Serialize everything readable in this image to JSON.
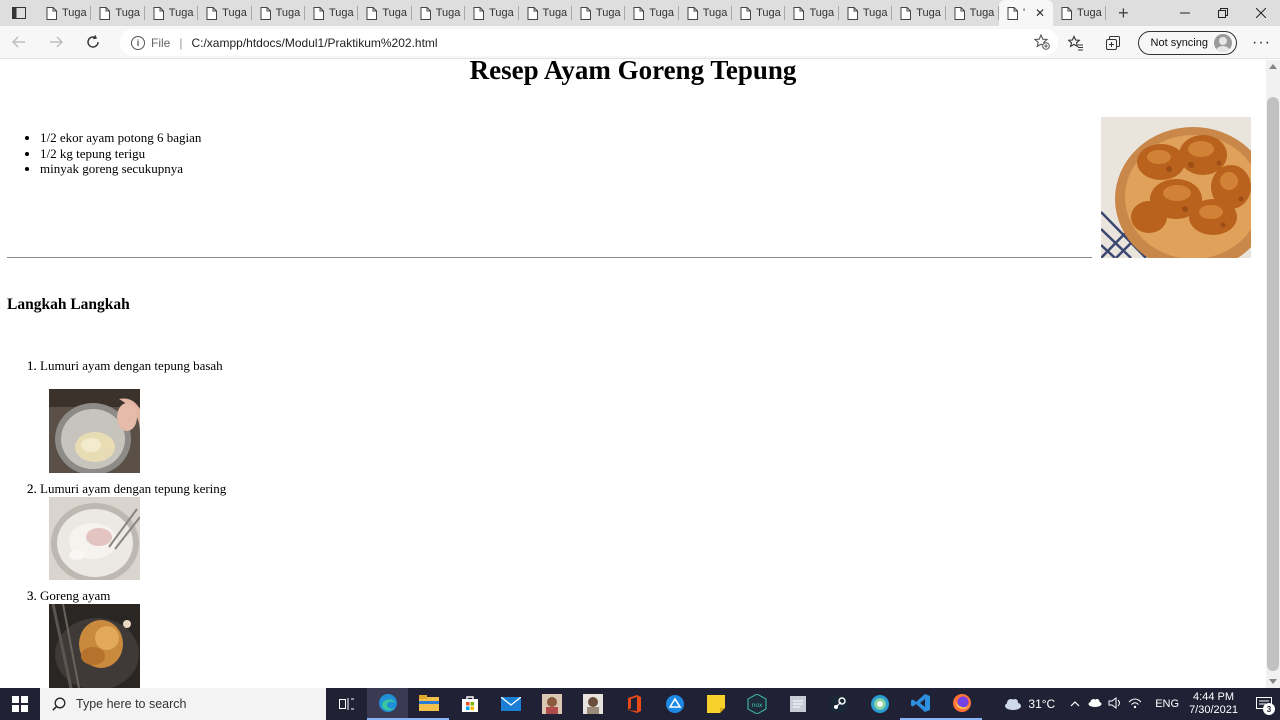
{
  "browser": {
    "tabs": [
      {
        "label": "Tuga"
      },
      {
        "label": "Tuga"
      },
      {
        "label": "Tuga"
      },
      {
        "label": "Tuga"
      },
      {
        "label": "Tuga"
      },
      {
        "label": "Tuga"
      },
      {
        "label": "Tuga"
      },
      {
        "label": "Tuga"
      },
      {
        "label": "Tuga"
      },
      {
        "label": "Tuga"
      },
      {
        "label": "Tuga"
      },
      {
        "label": "Tuga"
      },
      {
        "label": "Tuga"
      },
      {
        "label": "Tuga"
      },
      {
        "label": "Tuga"
      },
      {
        "label": "Tuga"
      },
      {
        "label": "Tuga"
      },
      {
        "label": "Tuga"
      },
      {
        "label": "'",
        "active": true
      },
      {
        "label": "Tuga"
      }
    ],
    "address": {
      "scheme_label": "File",
      "url": "C:/xampp/htdocs/Modul1/Praktikum%202.html"
    },
    "profile_label": "Not syncing"
  },
  "page": {
    "title": "Resep Ayam Goreng Tepung",
    "ingredients": [
      "1/2 ekor ayam potong 6 bagian",
      "1/2 kg tepung terigu",
      "minyak goreng secukupnya"
    ],
    "steps_heading": "Langkah Langkah",
    "steps": [
      {
        "num": "1.",
        "text": "Lumuri ayam dengan tepung basah"
      },
      {
        "num": "2.",
        "text": "Lumuri ayam dengan tepung kering"
      },
      {
        "num": "3.",
        "text": "Goreng ayam"
      }
    ]
  },
  "taskbar": {
    "search_placeholder": "Type here to search",
    "weather": "31°C",
    "language": "ENG",
    "time": "4:44 PM",
    "date": "7/30/2021",
    "notification_count": "3"
  },
  "colors": {
    "taskbar_bg": "#212135",
    "tabstrip_bg": "#dedede",
    "toolbar_bg": "#f7f7f7"
  }
}
